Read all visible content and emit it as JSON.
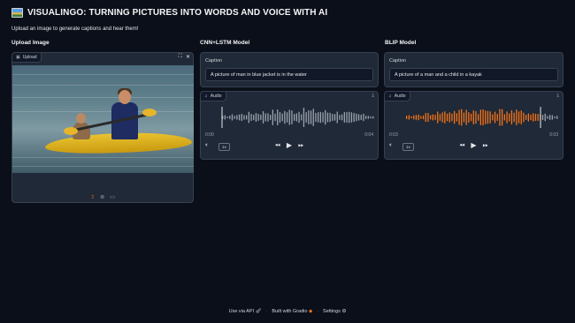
{
  "header": {
    "title": "VISUALINGO: TURNING PICTURES INTO WORDS AND VOICE WITH AI",
    "subtitle": "Upload an image to generate captions and hear them!"
  },
  "upload": {
    "section_label": "Upload Image",
    "tag": "Upload",
    "image_icon": "photo-icon"
  },
  "cnn": {
    "section_label": "CNN+LSTM Model",
    "caption_label": "Caption",
    "caption": "A picture of man in blue jacket is in the water",
    "audio_tag": "Audio",
    "time_start": "0:00",
    "time_end": "0:04",
    "rate": "1x",
    "progress": 0.0,
    "wave_color": "#9ca3af"
  },
  "blip": {
    "section_label": "BLIP Model",
    "caption_label": "Caption",
    "caption": "A picture of a man and a child in a kayak",
    "audio_tag": "Audio",
    "time_start": "0:03",
    "time_end": "0:03",
    "rate": "1x",
    "progress": 0.88,
    "wave_color": "#f97316"
  },
  "footer": {
    "api": "Use via API",
    "built": "Built with Gradio",
    "settings": "Settings"
  },
  "colors": {
    "accent": "#f97316",
    "background": "#0b0f19",
    "panel": "#1f2937"
  }
}
